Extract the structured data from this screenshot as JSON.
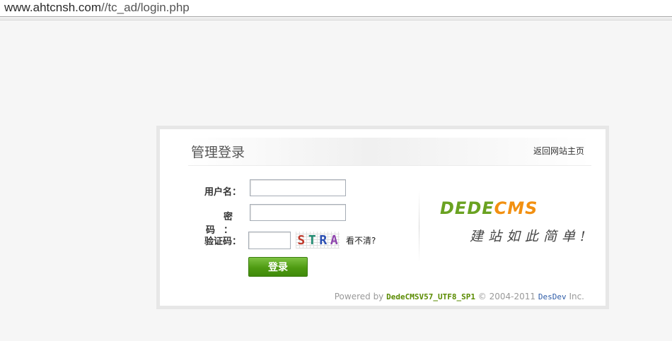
{
  "browser": {
    "url_host": "www.ahtcnsh.com",
    "url_path": "//tc_ad/login.php"
  },
  "panel": {
    "title": "管理登录",
    "back_link": "返回网站主页"
  },
  "form": {
    "username_label": "用户名：",
    "username_value": "",
    "password_label": "密 码：",
    "password_value": "",
    "captcha_label": "验证码：",
    "captcha_value": "",
    "captcha_chars": [
      "S",
      "T",
      "R",
      "A"
    ],
    "captcha_colors": [
      "#c0392b",
      "#1f8a70",
      "#2b4fb3",
      "#8e44ad"
    ],
    "captcha_refresh": "看不清?",
    "login_button": "登录"
  },
  "branding": {
    "logo_dede": "DEDE",
    "logo_cms": "CMS",
    "slogan": "建站如此简单!",
    "logo_colors": {
      "dede": "#6aa221",
      "cms": "#f29011"
    }
  },
  "footer": {
    "powered_by": "Powered by",
    "product": "DedeCMSV57_UTF8_SP1",
    "copyright": "© 2004-2011",
    "company": "DesDev",
    "inc": "Inc."
  }
}
